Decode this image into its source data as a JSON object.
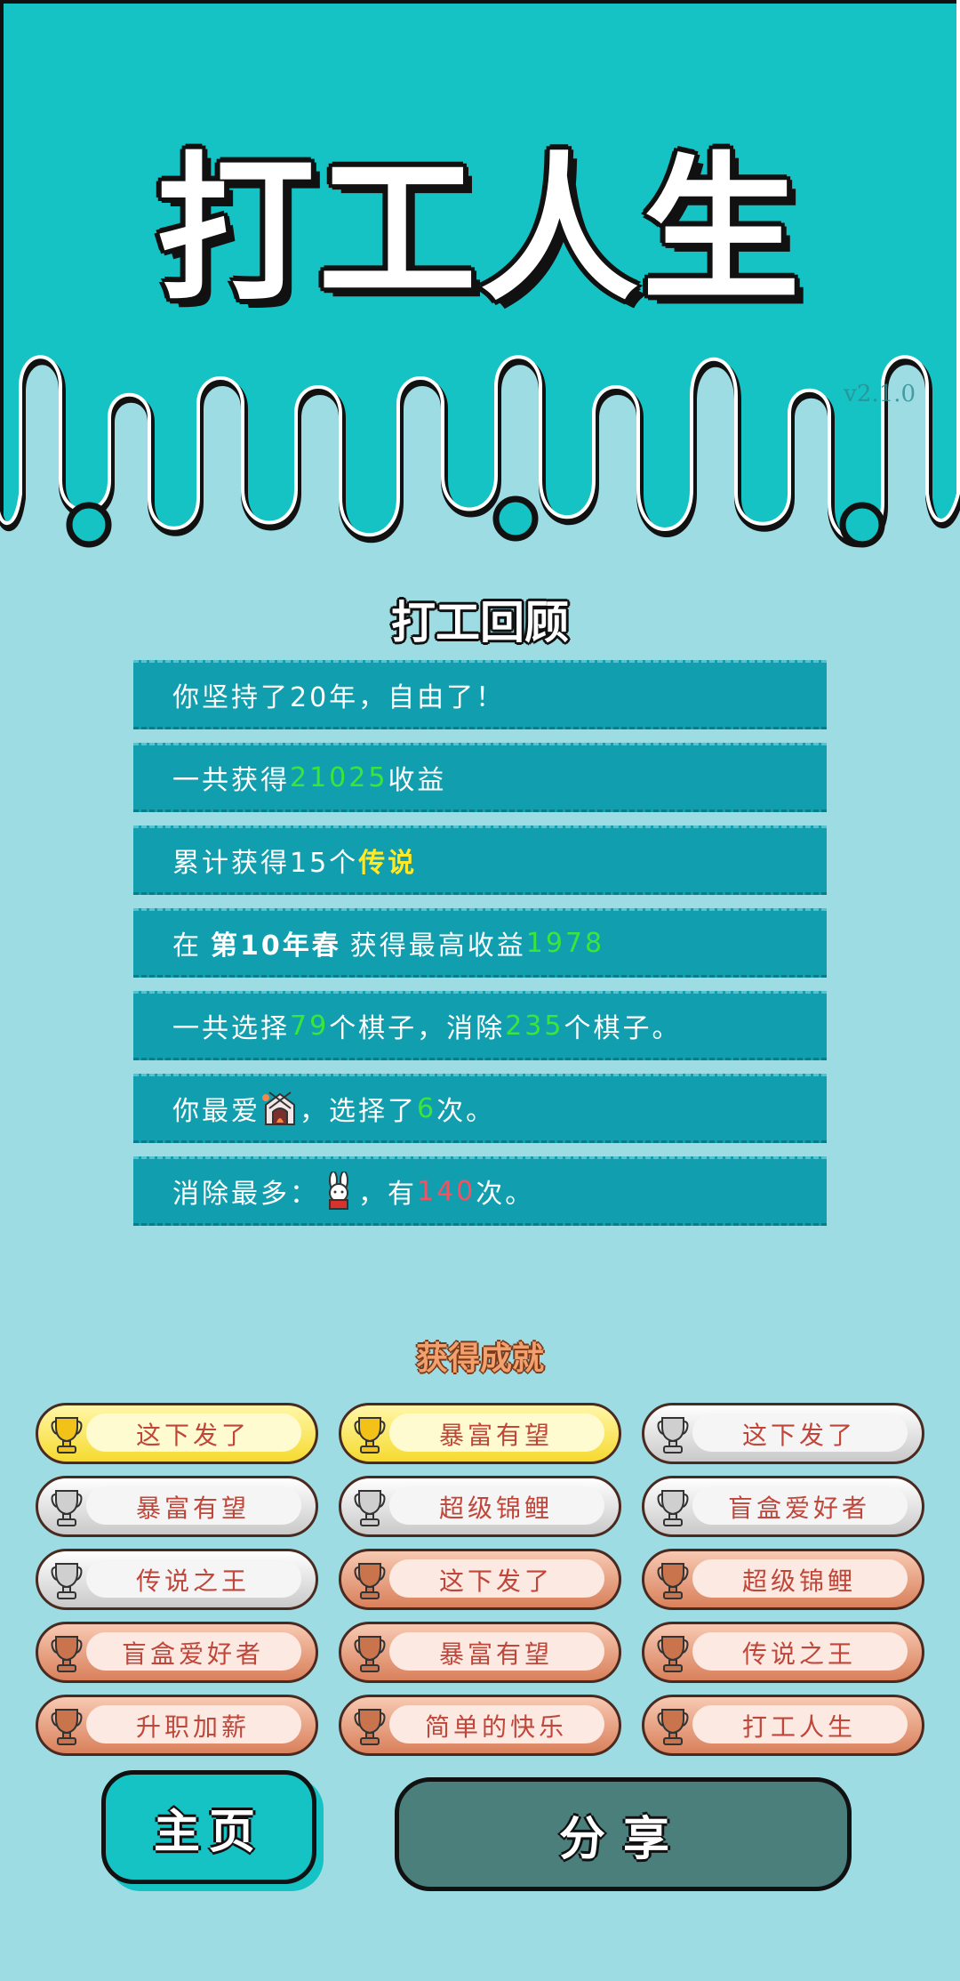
{
  "app": {
    "title": "打工人生",
    "version": "v2.1.0"
  },
  "review": {
    "title": "打工回顾",
    "row1": {
      "text": "你坚持了20年，自由了！"
    },
    "row2": {
      "pre": "一共获得",
      "value": "21025",
      "post": "收益"
    },
    "row3": {
      "pre": "累计获得15个",
      "highlight": "传说"
    },
    "row4": {
      "pre": "在",
      "season": "第10年春",
      "mid": "获得最高收益",
      "value": "1978"
    },
    "row5": {
      "pre": "一共选择",
      "value1": "79",
      "mid": "个棋子，消除",
      "value2": "235",
      "post": "个棋子。"
    },
    "row6": {
      "pre": "你最爱",
      "icon": "fireplace-icon",
      "mid": "，选择了",
      "value": "6",
      "post": "次。"
    },
    "row7": {
      "pre": "消除最多：",
      "icon": "rabbit-icon",
      "mid": "，有",
      "value": "140",
      "post": "次。"
    }
  },
  "achievements": {
    "title": "获得成就",
    "items": [
      {
        "label": "这下发了",
        "tier": "gold"
      },
      {
        "label": "暴富有望",
        "tier": "gold"
      },
      {
        "label": "这下发了",
        "tier": "silver"
      },
      {
        "label": "暴富有望",
        "tier": "silver"
      },
      {
        "label": "超级锦鲤",
        "tier": "silver"
      },
      {
        "label": "盲盒爱好者",
        "tier": "silver"
      },
      {
        "label": "传说之王",
        "tier": "silver"
      },
      {
        "label": "这下发了",
        "tier": "bronze"
      },
      {
        "label": "超级锦鲤",
        "tier": "bronze"
      },
      {
        "label": "盲盒爱好者",
        "tier": "bronze"
      },
      {
        "label": "暴富有望",
        "tier": "bronze"
      },
      {
        "label": "传说之王",
        "tier": "bronze"
      },
      {
        "label": "升职加薪",
        "tier": "bronze"
      },
      {
        "label": "简单的快乐",
        "tier": "bronze"
      },
      {
        "label": "打工人生",
        "tier": "bronze"
      }
    ]
  },
  "buttons": {
    "home": "主页",
    "share": "分享"
  },
  "colors": {
    "header_bg": "#15c2c4",
    "page_bg": "#9edce4",
    "row_bg": "#119faf",
    "green": "#39e639",
    "yellow": "#ffe926",
    "red": "#ff4d5e"
  }
}
